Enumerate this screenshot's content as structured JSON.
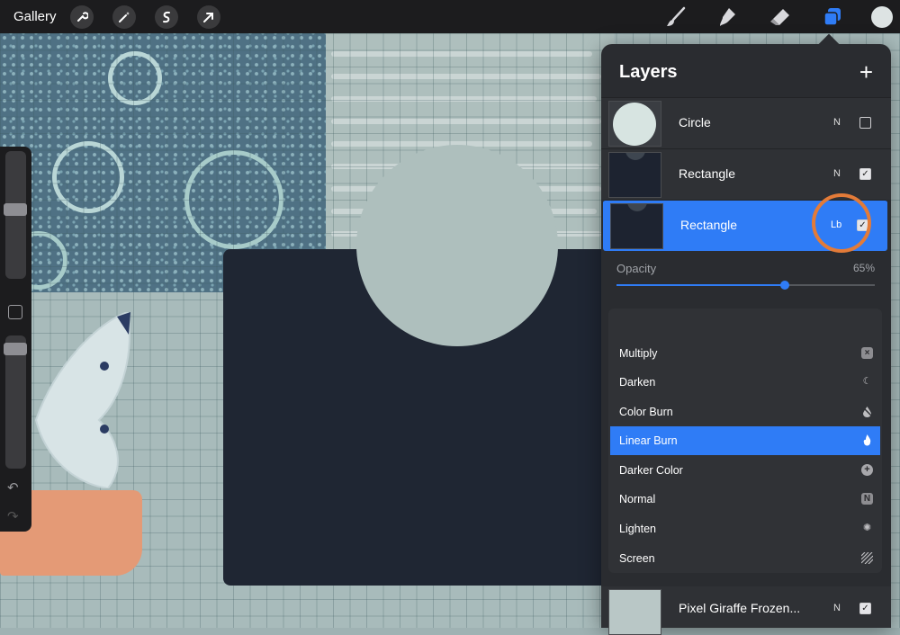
{
  "toolbar": {
    "gallery_label": "Gallery",
    "left_tools": [
      "wrench-icon",
      "magic-wand-icon",
      "selection-icon",
      "transform-arrow-icon"
    ],
    "right_tools": [
      "brush-icon",
      "smudge-icon",
      "eraser-icon",
      "layers-icon"
    ],
    "active_tool": "layers-icon",
    "color_well": "#dde3e3"
  },
  "layers_panel": {
    "title": "Layers",
    "add_icon": "plus-icon",
    "layers": [
      {
        "name": "Circle",
        "blend": "N",
        "visible": false,
        "thumb": "circle"
      },
      {
        "name": "Rectangle",
        "blend": "N",
        "visible": true,
        "thumb": "rect"
      },
      {
        "name": "Rectangle",
        "blend": "Lb",
        "visible": true,
        "thumb": "rect",
        "selected": true
      }
    ],
    "opacity_label": "Opacity",
    "opacity_value": "65%",
    "opacity_fraction": 0.65,
    "blend_modes": [
      {
        "name": "Multiply",
        "icon": "multiply-icon"
      },
      {
        "name": "Darken",
        "icon": "moon-icon"
      },
      {
        "name": "Color Burn",
        "icon": "burn-drop-icon"
      },
      {
        "name": "Linear Burn",
        "icon": "flame-icon",
        "selected": true
      },
      {
        "name": "Darker Color",
        "icon": "plus-circle-icon"
      },
      {
        "name": "Normal",
        "icon": "normal-n-icon"
      },
      {
        "name": "Lighten",
        "icon": "sun-icon"
      },
      {
        "name": "Screen",
        "icon": "hatch-icon"
      }
    ],
    "bottom_layer": {
      "name": "Pixel Giraffe Frozen...",
      "blend": "N",
      "visible": true
    }
  },
  "colors": {
    "accent": "#2f7cf6",
    "highlight_ring": "#e37b38",
    "toolbar_bg": "#1c1c1e",
    "panel_bg": "#2a2c30"
  }
}
